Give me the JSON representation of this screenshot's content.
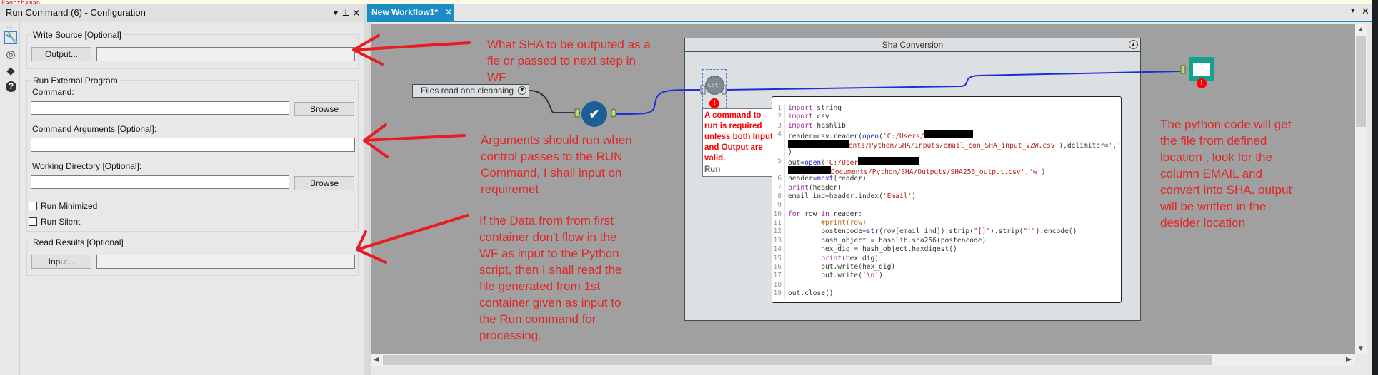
{
  "user_label": "Ragothaman",
  "config": {
    "title": "Run Command (6) - Configuration",
    "header_icons": [
      "dropdown-icon",
      "pin-icon",
      "close-icon"
    ],
    "sidebar_icons": [
      "wrench-icon",
      "compass-icon",
      "tag-icon",
      "help-icon"
    ],
    "write_source": {
      "label": "Write Source [Optional]",
      "button": "Output...",
      "value": ""
    },
    "run_external": {
      "label": "Run External Program",
      "command_label": "Command:",
      "command_value": "",
      "browse": "Browse",
      "args_label": "Command Arguments [Optional]:",
      "args_value": "",
      "workdir_label": "Working Directory [Optional]:",
      "workdir_value": "",
      "browse2": "Browse",
      "run_minimized": {
        "label": "Run Minimized",
        "checked": false
      },
      "run_silent": {
        "label": "Run Silent",
        "checked": false
      }
    },
    "read_results": {
      "label": "Read Results [Optional]",
      "button": "Input...",
      "value": ""
    }
  },
  "tab": {
    "label": "New Workflow1*",
    "close": "✕"
  },
  "window_controls": {
    "dropdown": "▾",
    "close": "✕"
  },
  "canvas": {
    "tool_container_label": "Files read and cleansing",
    "container_title": "Sha Conversion",
    "error_tip": {
      "message": "A command to run is required unless both Input and Output are valid.",
      "tool": "Run"
    },
    "run_command_icon_text": "C:\\_",
    "wire_colors": {
      "selected": "#1f2fd6",
      "default": "#333333"
    },
    "code_rows": [
      {
        "n": "1",
        "seg": [
          [
            "kw",
            "import"
          ],
          [
            "pl",
            " string"
          ]
        ]
      },
      {
        "n": "2",
        "seg": [
          [
            "kw",
            "import"
          ],
          [
            "pl",
            " csv"
          ]
        ]
      },
      {
        "n": "3",
        "seg": [
          [
            "kw",
            "import"
          ],
          [
            "pl",
            " hashlib"
          ]
        ]
      },
      {
        "n": "4",
        "seg": [
          [
            "pl",
            "reader=csv.reader("
          ],
          [
            "bi",
            "open"
          ],
          [
            "pl",
            "("
          ],
          [
            "str",
            "'C:/Users/"
          ],
          [
            "red",
            ""
          ]
        ]
      },
      {
        "n": "",
        "seg": [
          [
            "red",
            ""
          ],
          [
            "str",
            "ents/Python/SHA/Inputs/email_con_SHA_input_VZW.csv'"
          ],
          [
            "pl",
            "),delimiter="
          ],
          [
            "str",
            "','"
          ]
        ]
      },
      {
        "n": "",
        "seg": [
          [
            "pl",
            ")"
          ]
        ]
      },
      {
        "n": "5",
        "seg": [
          [
            "pl",
            "out="
          ],
          [
            "bi",
            "open"
          ],
          [
            "pl",
            "("
          ],
          [
            "str",
            "'C:/User"
          ],
          [
            "red",
            ""
          ]
        ]
      },
      {
        "n": "",
        "seg": [
          [
            "red",
            ""
          ],
          [
            "str",
            "Documents/Python/SHA/Outputs/SHA256_output.csv'"
          ],
          [
            "pl",
            ","
          ],
          [
            "str",
            "'w'"
          ],
          [
            "pl",
            ")"
          ]
        ]
      },
      {
        "n": "6",
        "seg": [
          [
            "pl",
            "header="
          ],
          [
            "bi",
            "next"
          ],
          [
            "pl",
            "(reader)"
          ]
        ]
      },
      {
        "n": "7",
        "seg": [
          [
            "kw",
            "print"
          ],
          [
            "pl",
            "(header)"
          ]
        ]
      },
      {
        "n": "8",
        "seg": [
          [
            "pl",
            "email_ind=header.index("
          ],
          [
            "str",
            "'Email'"
          ],
          [
            "pl",
            ")"
          ]
        ]
      },
      {
        "n": "9",
        "seg": []
      },
      {
        "n": "10",
        "seg": [
          [
            "kw",
            "for"
          ],
          [
            "pl",
            " row "
          ],
          [
            "kw",
            "in"
          ],
          [
            "pl",
            " reader:"
          ]
        ]
      },
      {
        "n": "11",
        "seg": [
          [
            "pl",
            "        "
          ],
          [
            "cmt",
            "#print(row)"
          ]
        ]
      },
      {
        "n": "12",
        "seg": [
          [
            "pl",
            "        postencode="
          ],
          [
            "bi",
            "str"
          ],
          [
            "pl",
            "(row[email_ind]).strip("
          ],
          [
            "str",
            "\"[]\""
          ],
          [
            "pl",
            ").strip("
          ],
          [
            "str",
            "\"'\""
          ],
          [
            "pl",
            ").encode()"
          ]
        ]
      },
      {
        "n": "13",
        "seg": [
          [
            "pl",
            "        hash_object = hashlib.sha256(postencode)"
          ]
        ]
      },
      {
        "n": "14",
        "seg": [
          [
            "pl",
            "        hex_dig = hash_object.hexdigest()"
          ]
        ]
      },
      {
        "n": "15",
        "seg": [
          [
            "pl",
            "        "
          ],
          [
            "kw",
            "print"
          ],
          [
            "pl",
            "(hex_dig)"
          ]
        ]
      },
      {
        "n": "16",
        "seg": [
          [
            "pl",
            "        out.write(hex_dig)"
          ]
        ]
      },
      {
        "n": "17",
        "seg": [
          [
            "pl",
            "        out.write("
          ],
          [
            "str",
            "'\\n'"
          ],
          [
            "pl",
            ")"
          ]
        ]
      },
      {
        "n": "18",
        "seg": []
      },
      {
        "n": "19",
        "seg": [
          [
            "pl",
            "out.close()"
          ]
        ]
      }
    ]
  },
  "annotations": {
    "color": "#e02828",
    "note_output": "What SHA to be outputed as a fle or passed to next step in WF",
    "note_arguments": "Arguments should run when control passes to the RUN Command, I shall input on requiremet",
    "note_input": "If the Data from from first container don't flow in the WF as input to the Python script, then I shall read the file generated from 1st container given as input to the Run command for processing.",
    "note_python": "The python code will get the file from defined location , look for the column EMAIL and convert into SHA. output will be written in the desider location"
  }
}
